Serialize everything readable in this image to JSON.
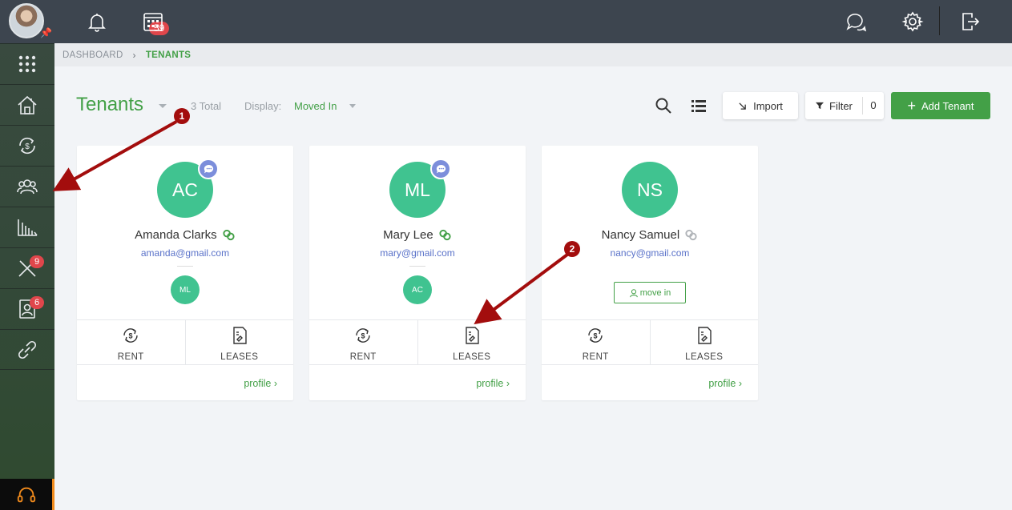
{
  "sidebar": {
    "badges": {
      "maintenance": "9",
      "applicants": "6"
    }
  },
  "topbar": {
    "notification_count": "59"
  },
  "breadcrumb": {
    "parent": "DASHBOARD",
    "current": "TENANTS"
  },
  "header": {
    "title": "Tenants",
    "total": "3 Total",
    "display_label": "Display:",
    "display_value": "Moved In",
    "import_label": "Import",
    "filter_label": "Filter",
    "filter_count": "0",
    "add_label": "Add Tenant"
  },
  "tenants": [
    {
      "initials": "AC",
      "name": "Amanda Clarks",
      "email": "amanda@gmail.com",
      "co_tenant": "ML",
      "status_color": "#43a047"
    },
    {
      "initials": "ML",
      "name": "Mary Lee",
      "email": "mary@gmail.com",
      "co_tenant": "AC",
      "status_color": "#43a047"
    },
    {
      "initials": "NS",
      "name": "Nancy Samuel",
      "email": "nancy@gmail.com",
      "move_in_label": "move in",
      "status_color": "#b0b4b8"
    }
  ],
  "card_actions": {
    "rent": "RENT",
    "leases": "LEASES",
    "profile": "profile"
  },
  "annotations": {
    "first": "1",
    "second": "2"
  },
  "colors": {
    "accent": "#43a047",
    "avatar": "#40c390",
    "arrow": "#a30d0d"
  }
}
